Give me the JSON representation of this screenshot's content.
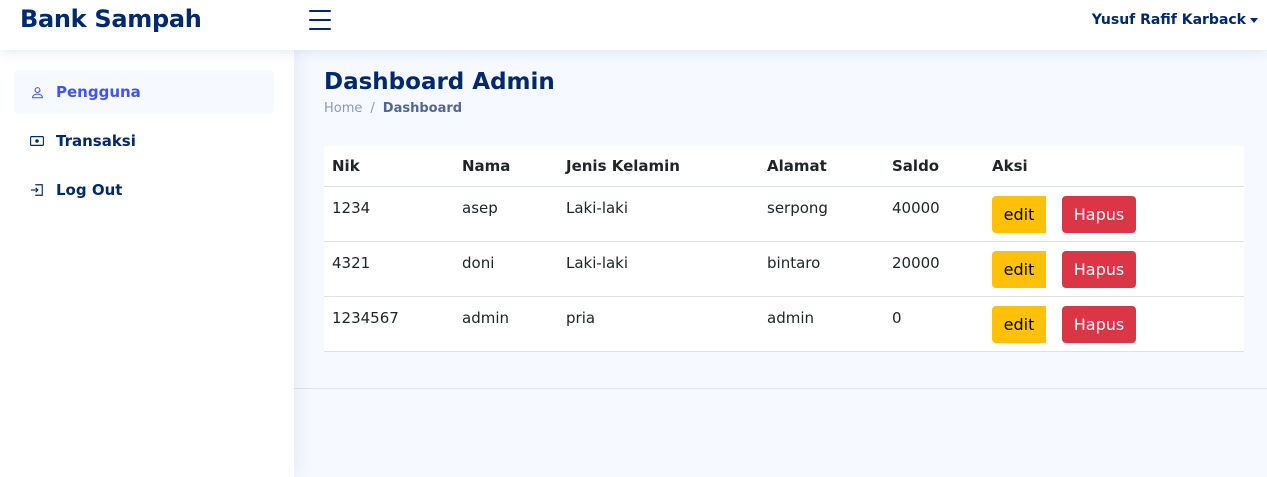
{
  "header": {
    "brand": "Bank Sampah",
    "user_name": "Yusuf Rafif Karback"
  },
  "sidebar": {
    "items": [
      {
        "label": "Pengguna",
        "icon": "person-icon",
        "active": true
      },
      {
        "label": "Transaksi",
        "icon": "cash-icon",
        "active": false
      },
      {
        "label": "Log Out",
        "icon": "box-arrow-in-right-icon",
        "active": false
      }
    ]
  },
  "main": {
    "title": "Dashboard Admin",
    "breadcrumb": {
      "home": "Home",
      "separator": "/",
      "current": "Dashboard"
    },
    "table": {
      "headers": [
        "Nik",
        "Nama",
        "Jenis Kelamin",
        "Alamat",
        "Saldo",
        "Aksi"
      ],
      "rows": [
        {
          "nik": "1234",
          "nama": "asep",
          "jenis_kelamin": "Laki-laki",
          "alamat": "serpong",
          "saldo": "40000",
          "edit": "edit",
          "hapus": "Hapus"
        },
        {
          "nik": "4321",
          "nama": "doni",
          "jenis_kelamin": "Laki-laki",
          "alamat": "bintaro",
          "saldo": "20000",
          "edit": "edit",
          "hapus": "Hapus"
        },
        {
          "nik": "1234567",
          "nama": "admin",
          "jenis_kelamin": "pria",
          "alamat": "admin",
          "saldo": "0",
          "edit": "edit",
          "hapus": "Hapus"
        }
      ]
    }
  },
  "colors": {
    "brand": "#012970",
    "accent": "#4154f1",
    "edit_button": "#ffc107",
    "delete_button": "#dc3545",
    "background": "#f6f9ff"
  }
}
